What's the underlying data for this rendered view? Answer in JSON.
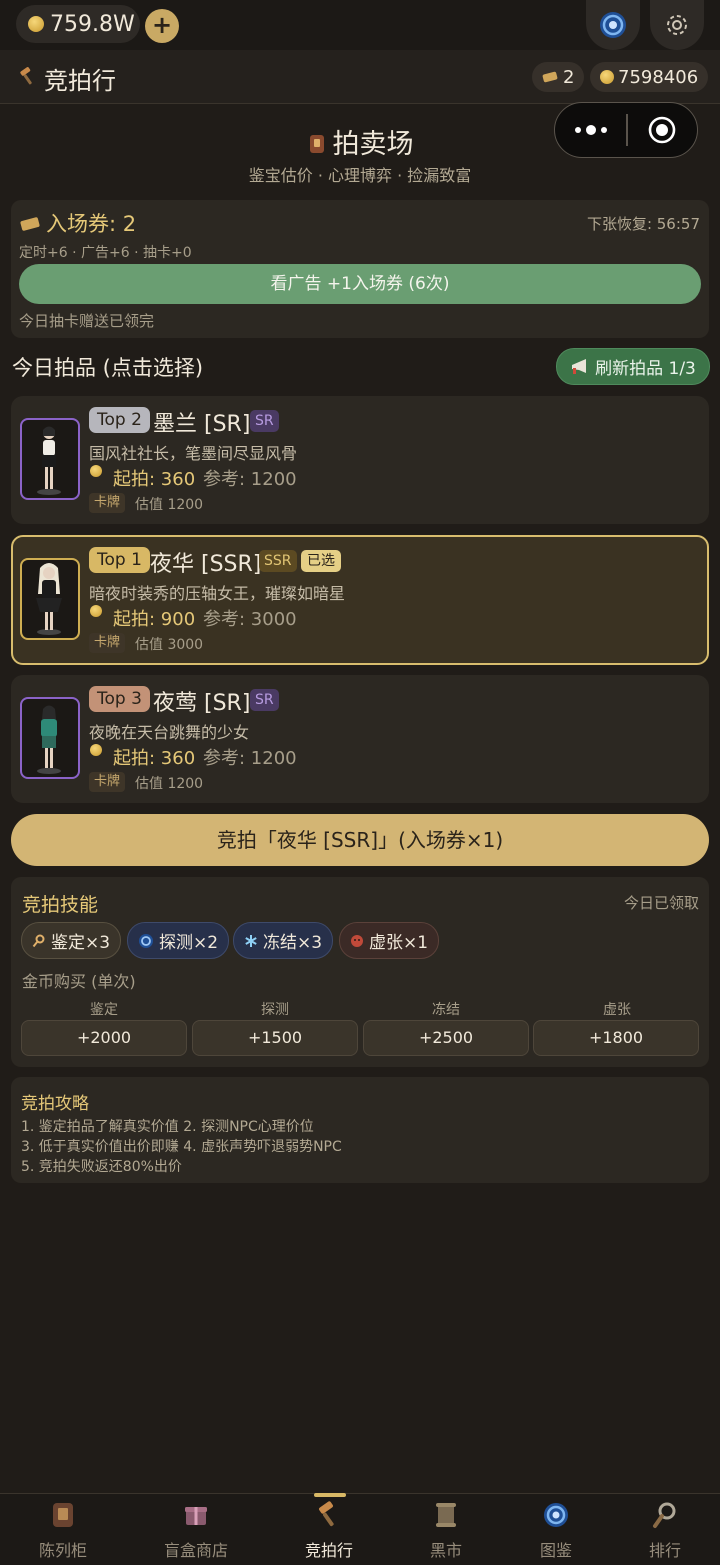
{
  "status": {
    "gold_balance": "759.8W",
    "add_label": "+"
  },
  "header": {
    "title": "竞拍行",
    "tickets": "2",
    "coins": "7598406"
  },
  "hall": {
    "title": "拍卖场",
    "subtitle": "鉴宝估价 · 心理博弈 · 捡漏致富"
  },
  "ticket_panel": {
    "title": "入场券: 2",
    "recovery": "下张恢复: 56:57",
    "sources": "定时+6 · 广告+6 · 抽卡+0",
    "ad_button": "看广告 +1入场券 (6次)",
    "note": "今日抽卡赠送已领完"
  },
  "items_section": {
    "title": "今日拍品 (点击选择)",
    "refresh_label": "刷新拍品 1/3"
  },
  "items": [
    {
      "rank": "Top 2",
      "name": "墨兰 [SR]",
      "tier": "SR",
      "desc": "国风社社长，笔墨间尽显风骨",
      "start": "起拍: 360",
      "ref": "参考: 1200",
      "tag": "卡牌",
      "estimate": "估值 1200"
    },
    {
      "rank": "Top 1",
      "name": "夜华 [SSR]",
      "tier": "SSR",
      "selected": "已选",
      "desc": "暗夜时装秀的压轴女王，璀璨如暗星",
      "start": "起拍: 900",
      "ref": "参考: 3000",
      "tag": "卡牌",
      "estimate": "估值 3000"
    },
    {
      "rank": "Top 3",
      "name": "夜莺 [SR]",
      "tier": "SR",
      "desc": "夜晚在天台跳舞的少女",
      "start": "起拍: 360",
      "ref": "参考: 1200",
      "tag": "卡牌",
      "estimate": "估值 1200"
    }
  ],
  "bid_button": "竞拍「夜华 [SSR]」(入场券×1)",
  "skills": {
    "title": "竞拍技能",
    "claimed": "今日已领取",
    "chips": [
      "鉴定×3",
      "探测×2",
      "冻结×3",
      "虚张×1"
    ],
    "buy_label": "金币购买 (单次)",
    "buy": [
      {
        "name": "鉴定",
        "price": "+2000"
      },
      {
        "name": "探测",
        "price": "+1500"
      },
      {
        "name": "冻结",
        "price": "+2500"
      },
      {
        "name": "虚张",
        "price": "+1800"
      }
    ]
  },
  "guide": {
    "title": "竞拍攻略",
    "lines": [
      "1. 鉴定拍品了解真实价值  2. 探测NPC心理价位",
      "3. 低于真实价值出价即赚  4. 虚张声势吓退弱势NPC",
      "5. 竞拍失败返还80%出价"
    ]
  },
  "nav": [
    "陈列柜",
    "盲盒商店",
    "竞拍行",
    "黑市",
    "图鉴",
    "排行"
  ],
  "colors": {
    "background": "#201c18",
    "accent_gold": "#d3b574",
    "accent_green": "#6a9e72",
    "sr_purple": "#8b63c8",
    "ssr_gold": "#cfae52"
  }
}
